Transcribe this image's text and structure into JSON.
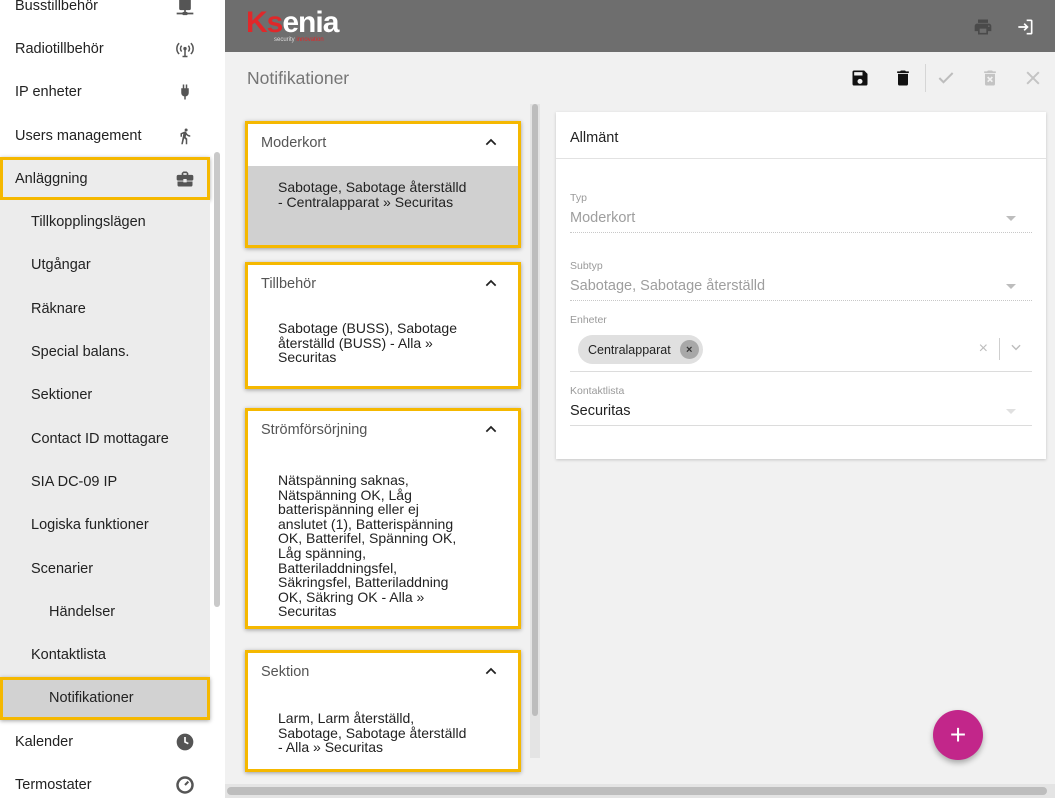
{
  "sidebar": {
    "items": [
      {
        "label": "Busstillbehör",
        "icon": "network-icon"
      },
      {
        "label": "Radiotillbehör",
        "icon": "radio-tower-icon"
      },
      {
        "label": "IP enheter",
        "icon": "plug-icon"
      },
      {
        "label": "Users management",
        "icon": "person-walking-icon"
      },
      {
        "label": "Anläggning",
        "icon": "briefcase-icon"
      },
      {
        "label": "Tillkopplingslägen"
      },
      {
        "label": "Utgångar"
      },
      {
        "label": "Räknare"
      },
      {
        "label": "Special balans."
      },
      {
        "label": "Sektioner"
      },
      {
        "label": "Contact ID mottagare"
      },
      {
        "label": "SIA DC-09 IP"
      },
      {
        "label": "Logiska funktioner"
      },
      {
        "label": "Scenarier"
      },
      {
        "label": "Händelser"
      },
      {
        "label": "Kontaktlista"
      },
      {
        "label": "Notifikationer"
      },
      {
        "label": "Kalender",
        "icon": "clock-icon"
      },
      {
        "label": "Termostater",
        "icon": "thermostat-icon"
      }
    ]
  },
  "header": {
    "logo": {
      "brand": "Ksenia",
      "brand_prefix": "K",
      "brand_s": "s",
      "brand_rest": "enia",
      "tagline_a": "security",
      "tagline_b": "innovation"
    },
    "buttons": {
      "print": "printer-icon",
      "logout": "logout-icon"
    }
  },
  "page": {
    "title": "Notifikationer"
  },
  "toolbar": {
    "icons": [
      "save-icon",
      "delete-icon",
      "check-icon",
      "delete-outline-icon",
      "close-icon"
    ]
  },
  "notifications": [
    {
      "title": "Moderkort",
      "text": "Sabotage, Sabotage återställd - Centralapparat » Securitas",
      "selected": true
    },
    {
      "title": "Tillbehör",
      "text": "Sabotage (BUSS), Sabotage återställd (BUSS) - Alla » Securitas"
    },
    {
      "title": "Strömförsörjning",
      "text": "Nätspänning saknas, Nätspänning OK, Låg batterispänning eller ej anslutet (1), Batterispänning OK, Batterifel, Spänning OK, Låg spänning, Batteriladdningsfel, Säkringsfel, Batteriladdning OK, Säkring OK - Alla » Securitas"
    },
    {
      "title": "Sektion",
      "text": "Larm, Larm återställd, Sabotage, Sabotage återställd - Alla » Securitas"
    }
  ],
  "form": {
    "title": "Allmänt",
    "typ": {
      "label": "Typ",
      "value": "Moderkort"
    },
    "subtyp": {
      "label": "Subtyp",
      "value": "Sabotage, Sabotage återställd"
    },
    "enheter": {
      "label": "Enheter",
      "chips": [
        "Centralapparat"
      ]
    },
    "kontaktlista": {
      "label": "Kontaktlista",
      "value": "Securitas"
    }
  },
  "fab": {
    "label": "+"
  },
  "colors": {
    "header": "#6e6e6e",
    "highlight": "#f5b800",
    "fab": "#c2268a",
    "brand_red": "#e0282a"
  }
}
